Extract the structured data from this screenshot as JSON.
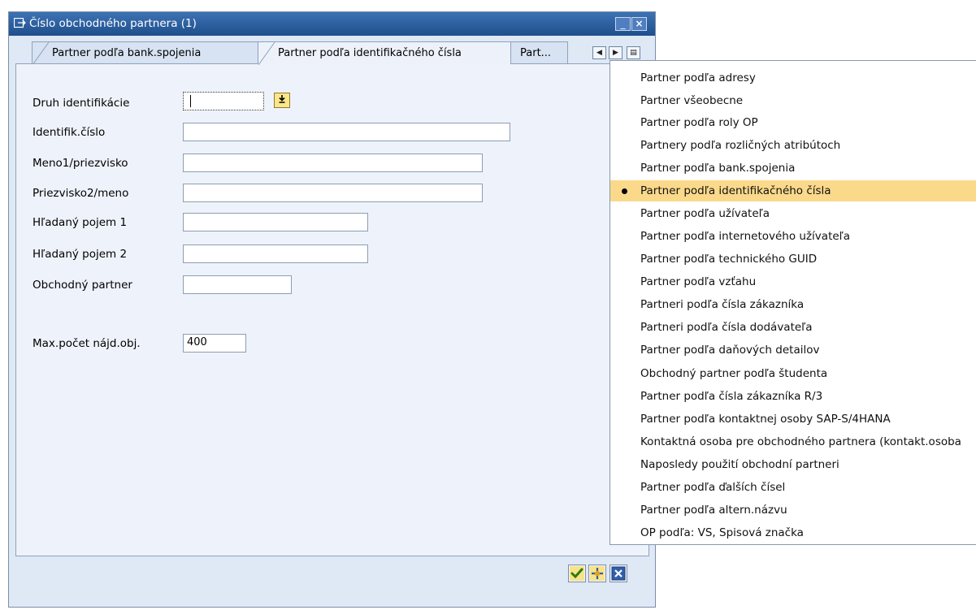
{
  "window": {
    "title": "Číslo obchodného partnera (1)",
    "minimize_symbol": "_",
    "close_symbol": "×"
  },
  "tabs": [
    {
      "label": "Partner podľa bank.spojenia",
      "active": false
    },
    {
      "label": "Partner podľa identifikačného čísla",
      "active": true
    },
    {
      "label": "Part...",
      "active": false
    }
  ],
  "tab_nav": {
    "left": "◀",
    "right": "▶",
    "list": "▤"
  },
  "form": {
    "druh_identifikacie": {
      "label": "Druh identifikácie",
      "value": ""
    },
    "identifik_cislo": {
      "label": "Identifik.číslo",
      "value": ""
    },
    "meno1": {
      "label": "Meno1/priezvisko",
      "value": ""
    },
    "priezvisko2": {
      "label": "Priezvisko2/meno",
      "value": ""
    },
    "hladany_pojem_1": {
      "label": "Hľadaný pojem 1",
      "value": ""
    },
    "hladany_pojem_2": {
      "label": "Hľadaný pojem 2",
      "value": ""
    },
    "obchodny_partner": {
      "label": "Obchodný partner",
      "value": ""
    },
    "max_pocet": {
      "label": "Max.počet nájd.obj.",
      "value": "400"
    }
  },
  "dropdown": {
    "items": [
      {
        "label": "Partner podľa adresy",
        "selected": false
      },
      {
        "label": "Partner všeobecne",
        "selected": false
      },
      {
        "label": "Partner podľa roly OP",
        "selected": false
      },
      {
        "label": "Partnery podľa rozličných atribútoch",
        "selected": false
      },
      {
        "label": "Partner podľa bank.spojenia",
        "selected": false
      },
      {
        "label": "Partner podľa identifikačného čísla",
        "selected": true
      },
      {
        "label": "Partner podľa užívateľa",
        "selected": false
      },
      {
        "label": "Partner podľa internetového užívateľa",
        "selected": false
      },
      {
        "label": "Partner podľa technického GUID",
        "selected": false
      },
      {
        "label": "Partner podľa vzťahu",
        "selected": false
      },
      {
        "label": "Partneri podľa čísla zákazníka",
        "selected": false
      },
      {
        "label": "Partneri podľa čísla dodávateľa",
        "selected": false
      },
      {
        "label": "Partner podľa daňových detailov",
        "selected": false
      },
      {
        "label": "Obchodný partner podľa študenta",
        "selected": false
      },
      {
        "label": "Partner podľa čísla zákazníka R/3",
        "selected": false
      },
      {
        "label": "Partner podľa kontaktnej osoby SAP-S/4HANA",
        "selected": false
      },
      {
        "label": "Kontaktná osoba pre obchodného partnera (kontakt.osoba",
        "selected": false
      },
      {
        "label": "Naposledy použití obchodní partneri",
        "selected": false
      },
      {
        "label": "Partner podľa ďalších čísel",
        "selected": false
      },
      {
        "label": "Partner podľa altern.názvu",
        "selected": false
      },
      {
        "label": "OP podľa: VS, Spisová značka",
        "selected": false
      }
    ]
  },
  "colors": {
    "titlebar": "#1f4f8c",
    "window_bg": "#dfe8f5",
    "selected_item": "#fbd98b",
    "f4_button": "#fbe68a"
  },
  "icons": {
    "title": "window-popup-icon",
    "f4": "value-help-icon",
    "ok": "checkmark-icon",
    "find": "find-icon",
    "cancel": "cancel-icon"
  }
}
